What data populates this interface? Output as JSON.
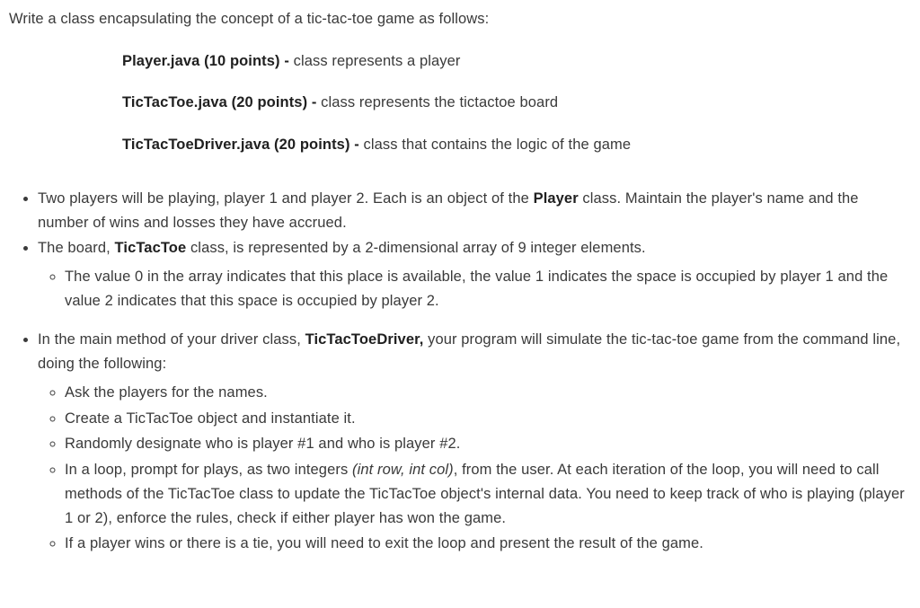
{
  "intro": "Write a class encapsulating the concept of a tic-tac-toe game as follows:",
  "files": [
    {
      "name": "Player.java (10 points) - ",
      "desc": "class represents a player"
    },
    {
      "name": "TicTacToe.java (20 points) - ",
      "desc": "class represents the tictactoe board"
    },
    {
      "name": "TicTacToeDriver.java (20 points) - ",
      "desc": "class that contains the logic of the game"
    }
  ],
  "b1": {
    "pre": "Two players will be playing, player 1 and player 2. Each is an object of the ",
    "b": "Player",
    "post": " class. Maintain the player's name and the number of wins and losses they have accrued."
  },
  "b2": {
    "pre": "The board, ",
    "b": "TicTacToe",
    "post": " class, is represented by a 2-dimensional array of 9 integer elements."
  },
  "b2s1": "The value 0 in the array indicates that this place is available, the value 1 indicates the space is occupied by player 1 and the value 2 indicates that this space is occupied by player 2.",
  "b3": {
    "pre": "In the main method of your driver class, ",
    "b": "TicTacToeDriver,",
    "post": " your program will simulate the tic-tac-toe game from the command line, doing the following:"
  },
  "b3s1": "Ask the players for the names.",
  "b3s2": "Create a TicTacToe object and instantiate it.",
  "b3s3": "Randomly designate who is player #1 and who is player #2.",
  "b3s4": {
    "pre": "In a loop, prompt for plays, as two integers ",
    "i": "(int row, int col)",
    "post": ", from the user. At each iteration of the loop, you will need to call methods of the TicTacToe class to update the TicTacToe object's internal data. You need to keep track of who is playing (player 1 or 2), enforce the rules, check if either player has won the game."
  },
  "b3s5": "If a player wins or there is a tie, you will need to exit the loop and present the result of the game."
}
